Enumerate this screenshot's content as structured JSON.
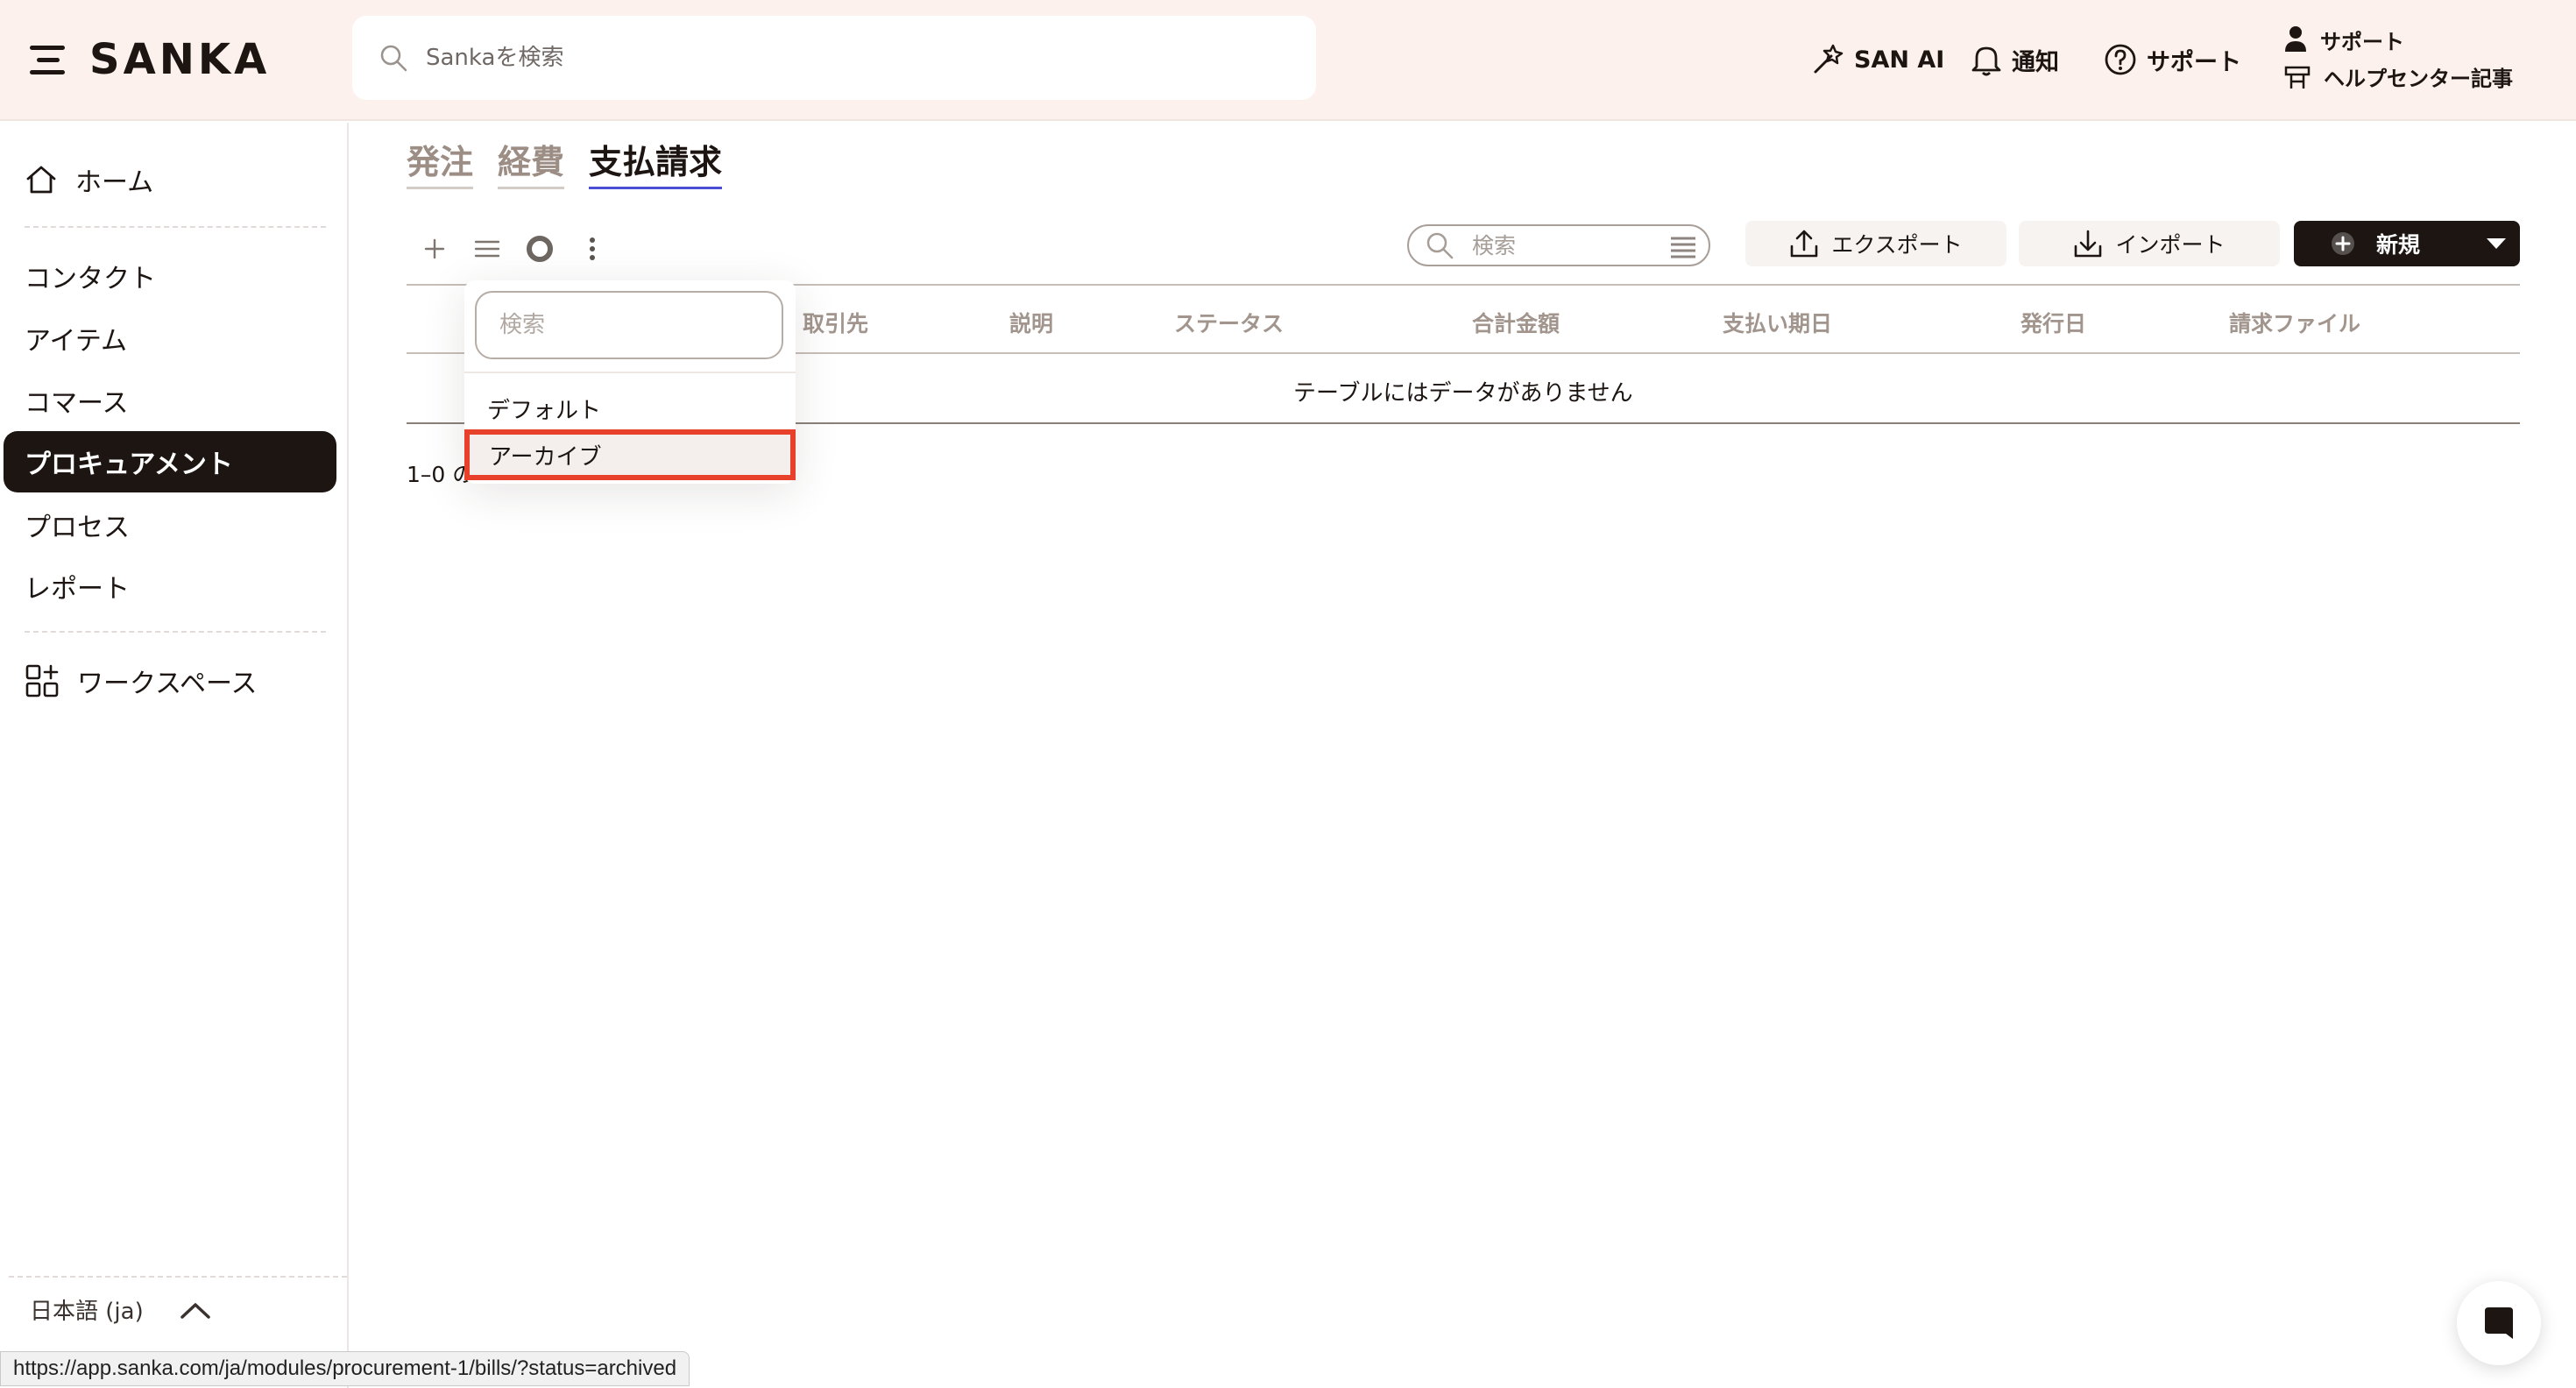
{
  "header": {
    "brand": "SANKA",
    "search_placeholder": "Sankaを検索",
    "san_ai": "SAN AI",
    "notifications": "通知",
    "support": "サポート",
    "support_user": "サポート",
    "help_center": "ヘルプセンター記事"
  },
  "sidebar": {
    "items": [
      {
        "label": "ホーム",
        "icon": "home-icon"
      },
      {
        "label": "コンタクト"
      },
      {
        "label": "アイテム"
      },
      {
        "label": "コマース"
      },
      {
        "label": "プロキュアメント",
        "active": true
      },
      {
        "label": "プロセス"
      },
      {
        "label": "レポート"
      },
      {
        "label": "ワークスペース",
        "icon": "workspace-icon"
      }
    ],
    "language": "日本語 (ja)"
  },
  "tabs": [
    {
      "label": "発注"
    },
    {
      "label": "経費"
    },
    {
      "label": "支払請求",
      "active": true
    }
  ],
  "toolbar": {
    "search_placeholder": "検索",
    "export": "エクスポート",
    "import": "インポート",
    "new": "新規"
  },
  "table": {
    "columns": [
      "取引先",
      "説明",
      "ステータス",
      "合計金額",
      "支払い期日",
      "発行日",
      "請求ファイル"
    ],
    "empty_message": "テーブルにはデータがありません",
    "pagination": "1–0 の"
  },
  "dropdown": {
    "search_placeholder": "検索",
    "items": [
      "デフォルト",
      "アーカイブ"
    ],
    "highlighted": "アーカイブ"
  },
  "status_bar": {
    "url": "https://app.sanka.com/ja/modules/procurement-1/bills/?status=archived"
  },
  "colors": {
    "header_bg": "#fcf1ec",
    "primary_dark": "#1c1512",
    "highlight_border": "#e8412b",
    "tab_underline": "#4a4ed6"
  }
}
